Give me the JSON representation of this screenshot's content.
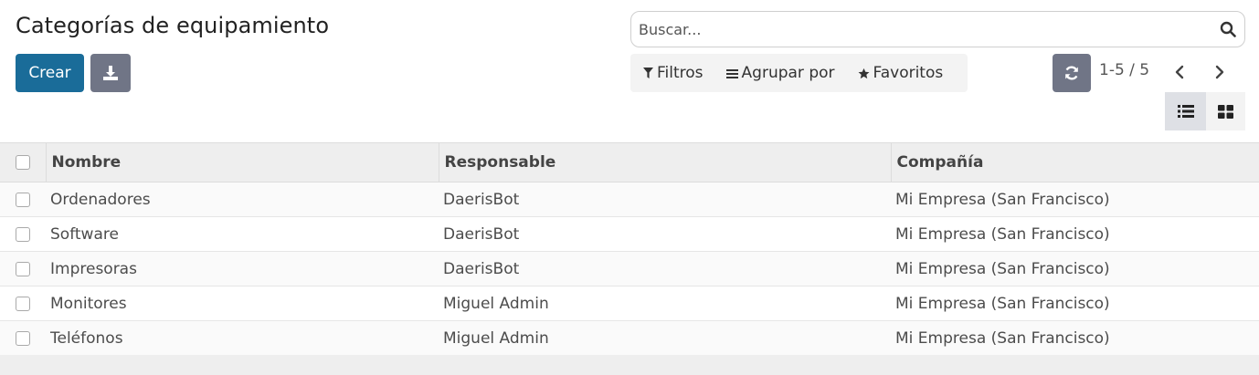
{
  "page": {
    "title": "Categorías de equipamiento"
  },
  "toolbar": {
    "create_label": "Crear",
    "download_icon": "download-icon",
    "refresh_icon": "refresh-icon"
  },
  "search": {
    "placeholder": "Buscar...",
    "icon": "search-icon"
  },
  "filters": {
    "filters_label": "Filtros",
    "group_by_label": "Agrupar por",
    "favorites_label": "Favoritos"
  },
  "pager": {
    "value": "1-5 / 5"
  },
  "views": [
    "list-view-icon",
    "kanban-view-icon"
  ],
  "table": {
    "columns": [
      "Nombre",
      "Responsable",
      "Compañía"
    ],
    "rows": [
      [
        "Ordenadores",
        "DaerisBot",
        "Mi Empresa (San Francisco)"
      ],
      [
        "Software",
        "DaerisBot",
        "Mi Empresa (San Francisco)"
      ],
      [
        "Impresoras",
        "DaerisBot",
        "Mi Empresa (San Francisco)"
      ],
      [
        "Monitores",
        "Miguel Admin",
        "Mi Empresa (San Francisco)"
      ],
      [
        "Teléfonos",
        "Miguel Admin",
        "Mi Empresa (San Francisco)"
      ]
    ]
  },
  "colors": {
    "primary": "#1a6c99",
    "secondary": "#707586",
    "header_bg": "#eeeeee"
  }
}
